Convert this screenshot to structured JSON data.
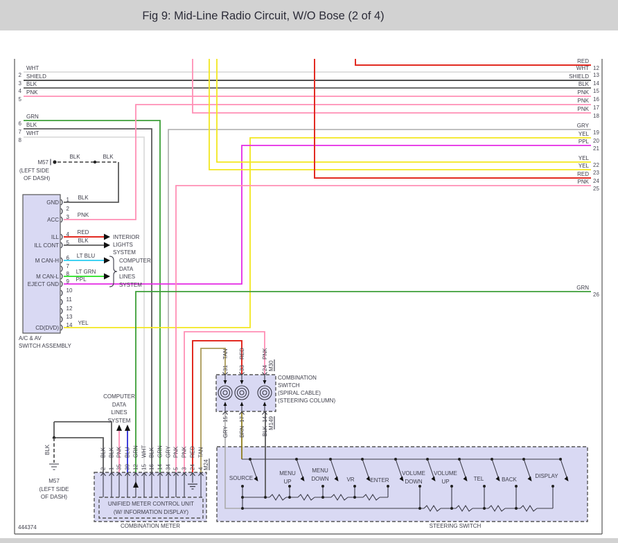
{
  "title": "Fig 9: Mid-Line Radio Circuit, W/O Bose (2 of 4)",
  "doc_number": "444374",
  "colors": {
    "RED": "#e22a21",
    "PNK": "#ff8fb5",
    "YEL": "#f2e71f",
    "GRN": "#3c9e37",
    "LT_GRN": "#41e53c",
    "LT_BLU": "#41d2f2",
    "BLU": "#2b2bd8",
    "PPL": "#e52ae5",
    "GRY": "#ababab",
    "WHT": "#dcdcdc",
    "BLK": "#5a5a5a",
    "SHIELD": "#161616",
    "TAN": "#ab9a57",
    "BRN": "#8e7d1c",
    "box_fill": "#d9d9f3",
    "title_band": "#d2d2d2"
  },
  "left_wires": [
    {
      "num": "2",
      "color": "WHT"
    },
    {
      "num": "3",
      "color": "SHIELD"
    },
    {
      "num": "4",
      "color": "BLK"
    },
    {
      "num": "5",
      "color": "PNK"
    },
    {
      "num": "6",
      "color": "GRN"
    },
    {
      "num": "7",
      "color": "BLK"
    },
    {
      "num": "8",
      "color": "WHT"
    }
  ],
  "right_wires": [
    {
      "num": "12",
      "color": "RED"
    },
    {
      "num": "13",
      "color": "WHT"
    },
    {
      "num": "14",
      "color": "SHIELD"
    },
    {
      "num": "15",
      "color": "BLK"
    },
    {
      "num": "16",
      "color": "PNK"
    },
    {
      "num": "17",
      "color": "PNK"
    },
    {
      "num": "18",
      "color": "PNK"
    },
    {
      "num": "19",
      "color": "GRY"
    },
    {
      "num": "20",
      "color": "YEL"
    },
    {
      "num": "21",
      "color": "PPL"
    },
    {
      "num": "22",
      "color": "YEL"
    },
    {
      "num": "23",
      "color": "YEL"
    },
    {
      "num": "24",
      "color": "RED"
    },
    {
      "num": "25",
      "color": "PNK"
    },
    {
      "num": "26",
      "color": "GRN"
    }
  ],
  "m57_top": {
    "name": "M57",
    "loc1": "(LEFT SIDE",
    "loc2": "OF DASH)",
    "seg1": "BLK",
    "seg2": "BLK"
  },
  "m57_bottom": {
    "name": "M57",
    "loc1": "(LEFT SIDE",
    "loc2": "OF DASH)",
    "wire": "BLK"
  },
  "av_switch": {
    "caption1": "A/C & AV",
    "caption2": "SWITCH ASSEMBLY",
    "pins": [
      {
        "num": "1",
        "label": "GND",
        "wire": "BLK"
      },
      {
        "num": "2",
        "label": "",
        "wire": ""
      },
      {
        "num": "3",
        "label": "ACC",
        "wire": "PNK"
      },
      {
        "num": "4",
        "label": "ILL",
        "wire": "RED"
      },
      {
        "num": "5",
        "label": "ILL CONT",
        "wire": "BLK"
      },
      {
        "num": "6",
        "label": "M CAN-H",
        "wire": "LT BLU"
      },
      {
        "num": "7",
        "label": "",
        "wire": ""
      },
      {
        "num": "8",
        "label": "M CAN-L",
        "wire": "LT GRN"
      },
      {
        "num": "9",
        "label": "EJECT GND",
        "wire": "PPL"
      },
      {
        "num": "10",
        "label": "",
        "wire": ""
      },
      {
        "num": "11",
        "label": "",
        "wire": ""
      },
      {
        "num": "12",
        "label": "",
        "wire": ""
      },
      {
        "num": "13",
        "label": "",
        "wire": ""
      },
      {
        "num": "14",
        "label": "CD(DVD)",
        "wire": "YEL"
      }
    ]
  },
  "interior_lights": {
    "l1": "INTERIOR",
    "l2": "LIGHTS",
    "l3": "SYSTEM"
  },
  "cdl1": {
    "l1": "COMPUTER",
    "l2": "DATA",
    "l3": "LINES",
    "l4": "SYSTEM"
  },
  "cdl2": {
    "l1": "COMPUTER",
    "l2": "DATA",
    "l3": "LINES",
    "l4": "SYSTEM"
  },
  "comb_switch": {
    "caption1": "COMBINATION",
    "caption2": "SWITCH",
    "caption3": "(SPIRAL CABLE)",
    "caption4": "(STEERING COLUMN)",
    "connector_top": "M30",
    "connector_bottom": "M149",
    "top_pins": [
      {
        "num": "31",
        "wire": "TAN"
      },
      {
        "num": "33",
        "wire": "RED"
      },
      {
        "num": "24",
        "wire": "PNK"
      }
    ],
    "bottom_pins": [
      {
        "num": "15",
        "wire": "GRY"
      },
      {
        "num": "17",
        "wire": "BRN"
      },
      {
        "num": "14",
        "wire": "BLK"
      }
    ]
  },
  "steering": {
    "caption": "STEERING SWITCH",
    "switches": [
      {
        "l1": "SOURCE",
        "l2": ""
      },
      {
        "l1": "MENU",
        "l2": "UP"
      },
      {
        "l1": "MENU",
        "l2": "DOWN"
      },
      {
        "l1": "VR",
        "l2": ""
      },
      {
        "l1": "ENTER",
        "l2": ""
      },
      {
        "l1": "VOLUME",
        "l2": "DOWN"
      },
      {
        "l1": "VOLUME",
        "l2": "UP"
      },
      {
        "l1": "TEL",
        "l2": ""
      },
      {
        "l1": "BACK",
        "l2": ""
      },
      {
        "l1": "DISPLAY",
        "l2": ""
      }
    ]
  },
  "meter": {
    "caption": "COMBINATION METER",
    "unit1": "UNIFIED METER CONTROL UNIT",
    "unit2": "(W/ INFORMATION DISPLAY)",
    "connector": "M24",
    "pins": [
      {
        "num": "2",
        "wire": "BLK"
      },
      {
        "num": "1",
        "wire": "BLK"
      },
      {
        "num": "35",
        "wire": "PNK"
      },
      {
        "num": "39",
        "wire": "BLU"
      },
      {
        "num": "12",
        "wire": "GRN"
      },
      {
        "num": "15",
        "wire": "WHT"
      },
      {
        "num": "16",
        "wire": "BLK"
      },
      {
        "num": "14",
        "wire": "GRN"
      },
      {
        "num": "34",
        "wire": "GRY"
      },
      {
        "num": "5",
        "wire": "PNK"
      },
      {
        "num": "3",
        "wire": "PNK"
      },
      {
        "num": "24",
        "wire": "RED"
      },
      {
        "num": "4",
        "wire": "TAN"
      }
    ]
  }
}
